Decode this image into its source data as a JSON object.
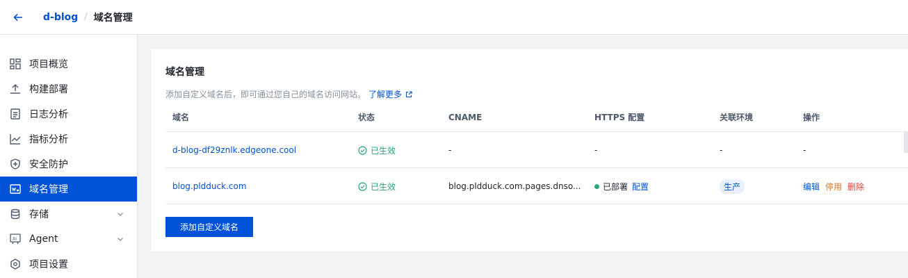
{
  "header": {
    "project": "d-blog",
    "separator": "/",
    "current": "域名管理"
  },
  "sidebar": {
    "items": [
      {
        "label": "项目概览",
        "icon": "dashboard-icon"
      },
      {
        "label": "构建部署",
        "icon": "upload-icon"
      },
      {
        "label": "日志分析",
        "icon": "document-icon"
      },
      {
        "label": "指标分析",
        "icon": "chart-line-icon"
      },
      {
        "label": "安全防护",
        "icon": "shield-icon"
      },
      {
        "label": "域名管理",
        "icon": "domain-icon",
        "active": true
      },
      {
        "label": "存储",
        "icon": "database-icon",
        "expandable": true
      },
      {
        "label": "Agent",
        "icon": "ai-icon",
        "expandable": true
      },
      {
        "label": "项目设置",
        "icon": "settings-icon"
      }
    ]
  },
  "card": {
    "title": "域名管理",
    "description": "添加自定义域名后，即可通过您自己的域名访问网站。",
    "learn_more": "了解更多"
  },
  "table": {
    "columns": [
      "域名",
      "状态",
      "CNAME",
      "HTTPS 配置",
      "关联环境",
      "操作"
    ],
    "rows": [
      {
        "domain": "d-blog-df29znlk.edgeone.cool",
        "status": "已生效",
        "cname": "-",
        "https": "-",
        "env": "-",
        "ops": "-"
      },
      {
        "domain": "blog.pldduck.com",
        "status": "已生效",
        "cname": "blog.pldduck.com.pages.dnso...",
        "https_status": "已部署",
        "https_config": "配置",
        "env": "生产",
        "op_edit": "编辑",
        "op_stop": "停用",
        "op_delete": "删除"
      }
    ]
  },
  "add_button": "添加自定义域名",
  "colors": {
    "primary": "#0052d9",
    "success": "#2ba471",
    "warning": "#e37318",
    "danger": "#d54941"
  }
}
